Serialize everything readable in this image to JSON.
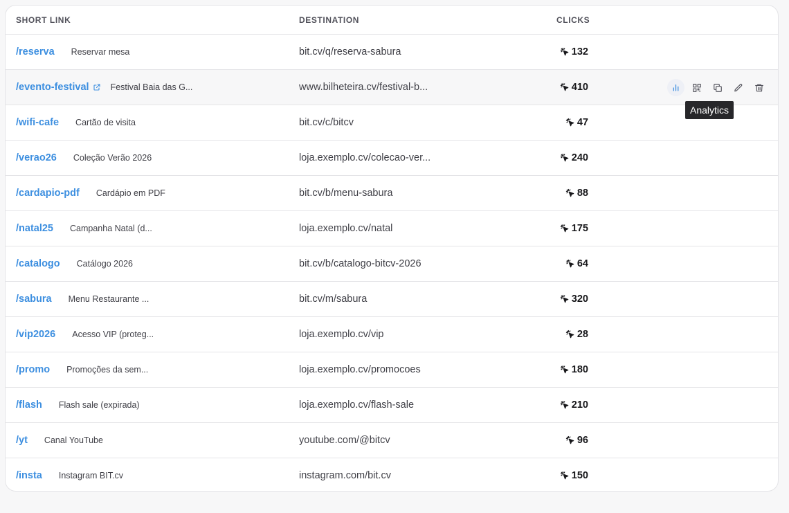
{
  "table": {
    "headers": {
      "short_link": "SHORT LINK",
      "destination": "DESTINATION",
      "clicks": "CLICKS"
    },
    "rows": [
      {
        "slug": "/reserva",
        "description": "Reservar mesa",
        "destination": "bit.cv/q/reserva-sabura",
        "clicks": "132",
        "external": false
      },
      {
        "slug": "/evento-festival",
        "description": "Festival Baia das G...",
        "destination": "www.bilheteira.cv/festival-b...",
        "clicks": "410",
        "external": true
      },
      {
        "slug": "/wifi-cafe",
        "description": "Cartão de visita",
        "destination": "bit.cv/c/bitcv",
        "clicks": "47",
        "external": false
      },
      {
        "slug": "/verao26",
        "description": "Coleção Verão 2026",
        "destination": "loja.exemplo.cv/colecao-ver...",
        "clicks": "240",
        "external": false
      },
      {
        "slug": "/cardapio-pdf",
        "description": "Cardápio em PDF",
        "destination": "bit.cv/b/menu-sabura",
        "clicks": "88",
        "external": false
      },
      {
        "slug": "/natal25",
        "description": "Campanha Natal (d...",
        "destination": "loja.exemplo.cv/natal",
        "clicks": "175",
        "external": false
      },
      {
        "slug": "/catalogo",
        "description": "Catálogo 2026",
        "destination": "bit.cv/b/catalogo-bitcv-2026",
        "clicks": "64",
        "external": false
      },
      {
        "slug": "/sabura",
        "description": "Menu Restaurante ...",
        "destination": "bit.cv/m/sabura",
        "clicks": "320",
        "external": false
      },
      {
        "slug": "/vip2026",
        "description": "Acesso VIP (proteg...",
        "destination": "loja.exemplo.cv/vip",
        "clicks": "28",
        "external": false
      },
      {
        "slug": "/promo",
        "description": "Promoções da sem...",
        "destination": "loja.exemplo.cv/promocoes",
        "clicks": "180",
        "external": false
      },
      {
        "slug": "/flash",
        "description": "Flash sale (expirada)",
        "destination": "loja.exemplo.cv/flash-sale",
        "clicks": "210",
        "external": false
      },
      {
        "slug": "/yt",
        "description": "Canal YouTube",
        "destination": "youtube.com/@bitcv",
        "clicks": "96",
        "external": false
      },
      {
        "slug": "/insta",
        "description": "Instagram BIT.cv",
        "destination": "instagram.com/bit.cv",
        "clicks": "150",
        "external": false
      }
    ],
    "hovered_row": 1
  },
  "row_actions": {
    "icons": [
      "bar-chart-icon",
      "qr-code-icon",
      "copy-icon",
      "edit-icon",
      "trash-icon"
    ],
    "active": "bar-chart-icon"
  },
  "tooltip": {
    "text": "Analytics"
  },
  "colors": {
    "link": "#3d8fe0",
    "text": "#3f3f46",
    "border": "#e4e4e7",
    "tooltip_bg": "#27272a"
  }
}
